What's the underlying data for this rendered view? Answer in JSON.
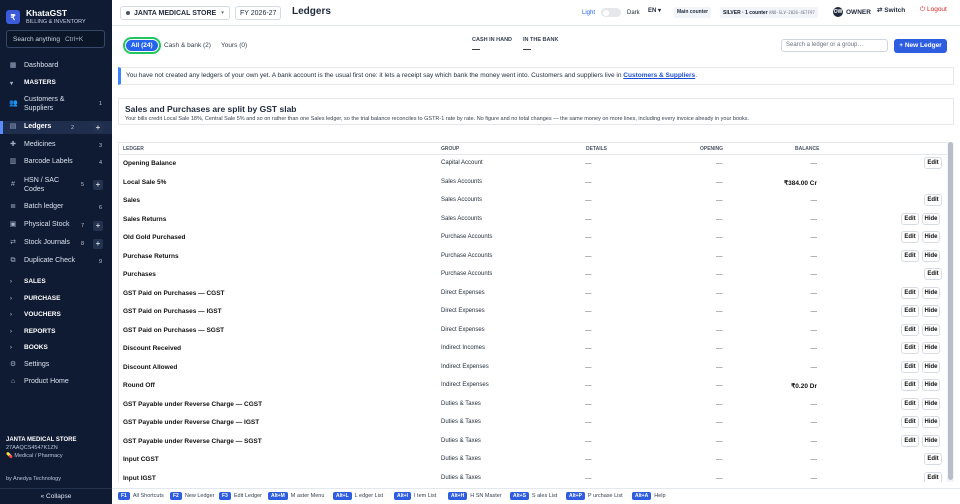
{
  "brand": {
    "name": "KhataGST",
    "sub": "BILLING & INVENTORY",
    "logo": "₹"
  },
  "sidebar": {
    "search_placeholder": "Search anything",
    "search_shortcut": "Ctrl+K",
    "dashboard": "Dashboard",
    "masters_label": "MASTERS",
    "items": [
      {
        "label": "Customers & Suppliers",
        "count": "1"
      },
      {
        "label": "Ledgers",
        "count": "2"
      },
      {
        "label": "Medicines",
        "count": "3"
      },
      {
        "label": "Barcode Labels",
        "count": "4"
      },
      {
        "label": "HSN / SAC Codes",
        "count": "5"
      },
      {
        "label": "Batch ledger",
        "count": "6"
      },
      {
        "label": "Physical Stock",
        "count": "7"
      },
      {
        "label": "Stock Journals",
        "count": "8"
      },
      {
        "label": "Duplicate Check",
        "count": "9"
      }
    ],
    "sections": [
      "SALES",
      "PURCHASE",
      "VOUCHERS",
      "REPORTS",
      "BOOKS"
    ],
    "settings": "Settings",
    "product_home": "Product Home",
    "company_name": "JANTA MEDICAL STORE",
    "company_gst": "27AAQCS4547K1ZN",
    "company_type": "Medical / Pharmacy",
    "by": "by Anedya Technology",
    "collapse": "« Collapse"
  },
  "topbar": {
    "store": "JANTA MEDICAL STORE",
    "fy": "FY 2026-27",
    "title": "Ledgers",
    "theme_light": "Light",
    "theme_dark": "Dark",
    "lang": "EN",
    "counter": "Main counter",
    "plan_label": "SILVER · 1 counter",
    "plan_code": "ANO-SLV-2026-4E7F97",
    "owner_initials": "OW",
    "owner": "OWNER",
    "switch": "Switch",
    "logout": "Logout"
  },
  "tabs": {
    "all": "All (24)",
    "cash_bank": "Cash & bank (2)",
    "yours": "Yours (0)",
    "cash_in_hand": "CASH IN HAND",
    "cash_in_hand_value": "—",
    "in_bank": "IN THE BANK",
    "in_bank_value": "—",
    "search_placeholder": "Search a ledger or a group…",
    "new_ledger": "+ New Ledger"
  },
  "notice": {
    "text": "You have not created any ledgers of your own yet. A bank account is the usual first one: it lets a receipt say which bank the money went into. Customers and suppliers live in",
    "link": "Customers & Suppliers",
    "end": "."
  },
  "gst_card": {
    "title": "Sales and Purchases are split by GST slab",
    "body": "Your bills credit Local Sale 18%, Central Sale 5% and so on rather than one Sales ledger, so the trial balance reconciles to GSTR-1 rate by rate. No figure and no total changes — the same money on more lines, including every invoice already in your books."
  },
  "table": {
    "headers": {
      "ledger": "LEDGER",
      "group": "GROUP",
      "details": "DETAILS",
      "opening": "OPENING",
      "balance": "BALANCE"
    },
    "edit": "Edit",
    "hide": "Hide",
    "rows": [
      {
        "name": "Opening Balance",
        "group": "Capital Account",
        "details": "—",
        "opening": "—",
        "balance": "—",
        "hide": false
      },
      {
        "name": "Local Sale 5%",
        "group": "Sales Accounts",
        "details": "—",
        "opening": "—",
        "balance": "₹384.00 Cr",
        "hide": false,
        "noedit": true
      },
      {
        "name": "Sales",
        "group": "Sales Accounts",
        "details": "—",
        "opening": "—",
        "balance": "—",
        "hide": false
      },
      {
        "name": "Sales Returns",
        "group": "Sales Accounts",
        "details": "—",
        "opening": "—",
        "balance": "—",
        "hide": true
      },
      {
        "name": "Old Gold Purchased",
        "group": "Purchase Accounts",
        "details": "—",
        "opening": "—",
        "balance": "—",
        "hide": true
      },
      {
        "name": "Purchase Returns",
        "group": "Purchase Accounts",
        "details": "—",
        "opening": "—",
        "balance": "—",
        "hide": true
      },
      {
        "name": "Purchases",
        "group": "Purchase Accounts",
        "details": "—",
        "opening": "—",
        "balance": "—",
        "hide": false
      },
      {
        "name": "GST Paid on Purchases — CGST",
        "group": "Direct Expenses",
        "details": "—",
        "opening": "—",
        "balance": "—",
        "hide": true
      },
      {
        "name": "GST Paid on Purchases — IGST",
        "group": "Direct Expenses",
        "details": "—",
        "opening": "—",
        "balance": "—",
        "hide": true
      },
      {
        "name": "GST Paid on Purchases — SGST",
        "group": "Direct Expenses",
        "details": "—",
        "opening": "—",
        "balance": "—",
        "hide": true
      },
      {
        "name": "Discount Received",
        "group": "Indirect Incomes",
        "details": "—",
        "opening": "—",
        "balance": "—",
        "hide": true
      },
      {
        "name": "Discount Allowed",
        "group": "Indirect Expenses",
        "details": "—",
        "opening": "—",
        "balance": "—",
        "hide": true
      },
      {
        "name": "Round Off",
        "group": "Indirect Expenses",
        "details": "—",
        "opening": "—",
        "balance": "₹0.20 Dr",
        "hide": true
      },
      {
        "name": "GST Payable under Reverse Charge — CGST",
        "group": "Duties & Taxes",
        "details": "—",
        "opening": "—",
        "balance": "—",
        "hide": true
      },
      {
        "name": "GST Payable under Reverse Charge — IGST",
        "group": "Duties & Taxes",
        "details": "—",
        "opening": "—",
        "balance": "—",
        "hide": true
      },
      {
        "name": "GST Payable under Reverse Charge — SGST",
        "group": "Duties & Taxes",
        "details": "—",
        "opening": "—",
        "balance": "—",
        "hide": true
      },
      {
        "name": "Input CGST",
        "group": "Duties & Taxes",
        "details": "—",
        "opening": "—",
        "balance": "—",
        "hide": false
      },
      {
        "name": "Input IGST",
        "group": "Duties & Taxes",
        "details": "—",
        "opening": "—",
        "balance": "—",
        "hide": false
      }
    ]
  },
  "footer": [
    {
      "key": "F1",
      "label": "All Shortcuts"
    },
    {
      "key": "F2",
      "label": "New Ledger"
    },
    {
      "key": "F3",
      "label": "Edit Ledger"
    },
    {
      "key": "Alt+M",
      "label": "M aster Menu"
    },
    {
      "key": "Alt+L",
      "label": "L edger List"
    },
    {
      "key": "Alt+I",
      "label": "I tem List"
    },
    {
      "key": "Alt+H",
      "label": "H SN Master"
    },
    {
      "key": "Alt+S",
      "label": "S ales List"
    },
    {
      "key": "Alt+P",
      "label": "P urchase List"
    },
    {
      "key": "Alt+A",
      "label": "Help"
    }
  ]
}
